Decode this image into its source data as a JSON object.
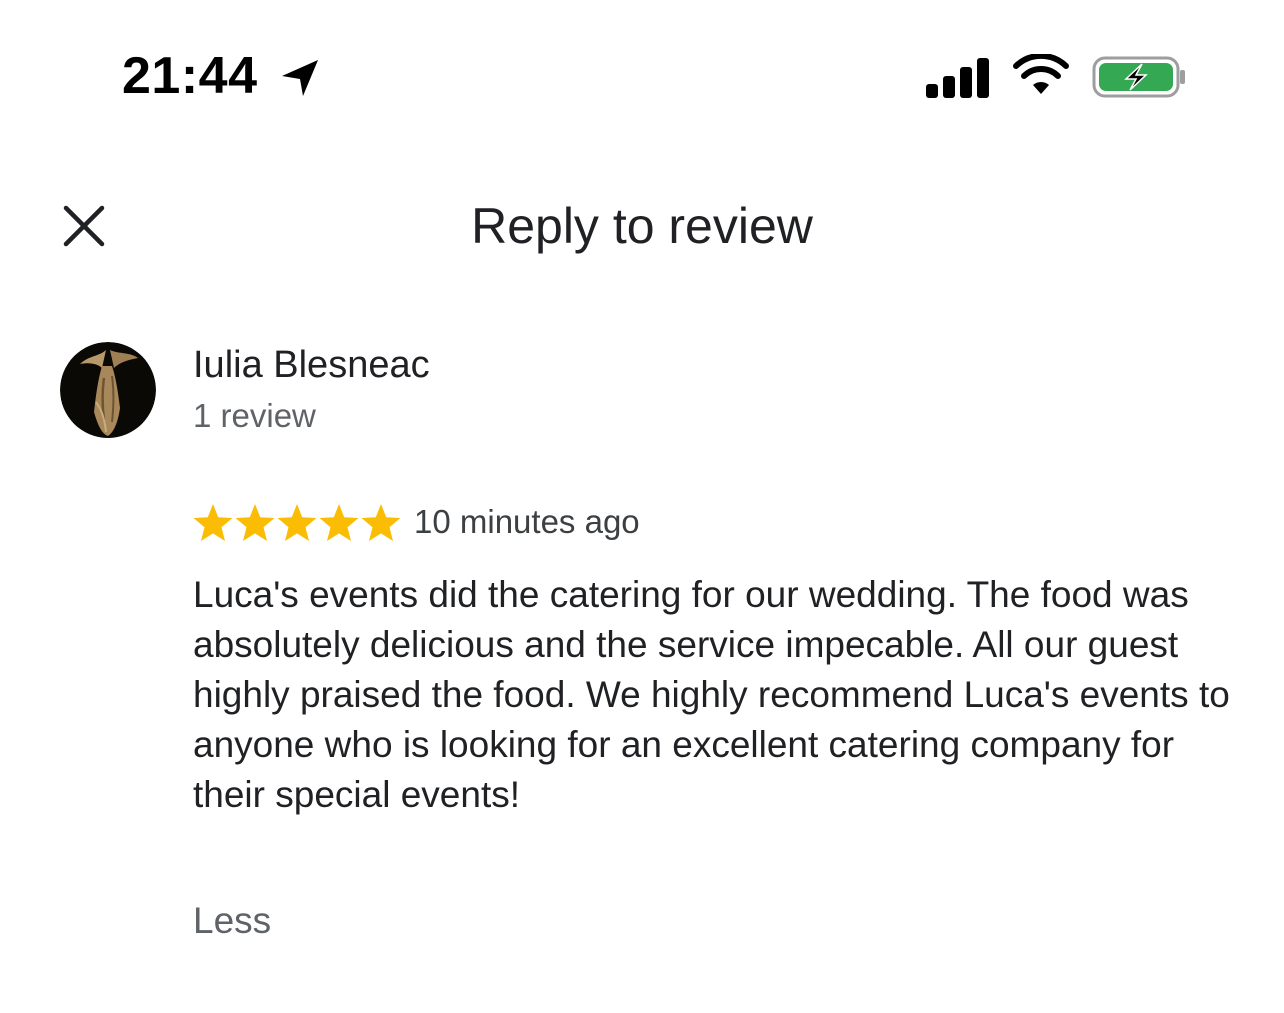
{
  "status_bar": {
    "time": "21:44",
    "icons": [
      "location-arrow-icon",
      "cellular-signal-icon",
      "wifi-icon",
      "battery-charging-icon"
    ],
    "battery_color": "#34a853"
  },
  "header": {
    "title": "Reply to review",
    "close_icon": "close-icon"
  },
  "review": {
    "reviewer_name": "Iulia Blesneac",
    "reviewer_review_count": "1 review",
    "rating": 5,
    "rating_max": 5,
    "star_color": "#fbbc04",
    "time_ago": "10 minutes ago",
    "text": "Luca's events did the catering for our wedding. The food was absolutely delicious and the service impecable. All our guest highly praised the food. We highly recommend Luca's events to anyone who is looking for an excellent catering company for their special events!",
    "collapse_label": "Less"
  }
}
